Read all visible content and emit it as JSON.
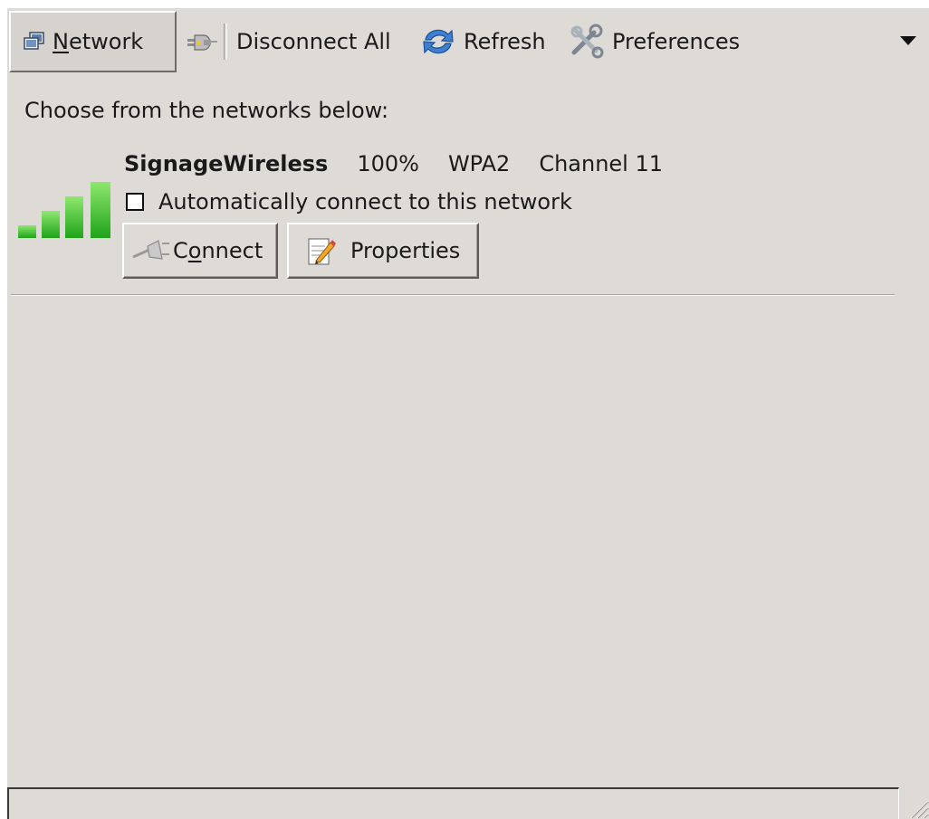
{
  "toolbar": {
    "network": {
      "label_first": "N",
      "label_rest": "etwork",
      "icon": "network-icon"
    },
    "disconnect_all": {
      "label": "Disconnect All",
      "icon": "plug-icon"
    },
    "refresh": {
      "label": "Refresh",
      "icon": "refresh-icon"
    },
    "preferences": {
      "label": "Preferences",
      "icon": "tools-icon"
    },
    "overflow": {
      "icon": "chevron-down-icon"
    }
  },
  "prompt": "Choose from the networks below:",
  "network": {
    "ssid": "SignageWireless",
    "strength": "100%",
    "signal_level": 1.0,
    "security": "WPA2",
    "channel": "Channel 11",
    "auto_connect_label": "Automatically connect to this network",
    "auto_connect_checked": false,
    "connect_button": {
      "pre": "C",
      "accel": "o",
      "post": "nnect",
      "icon": "plug-icon"
    },
    "properties_button": {
      "label": "Properties",
      "icon": "edit-document-icon"
    }
  },
  "colors": {
    "window_bg": "#dedbd6",
    "signal_green": "#3bbf2a"
  }
}
